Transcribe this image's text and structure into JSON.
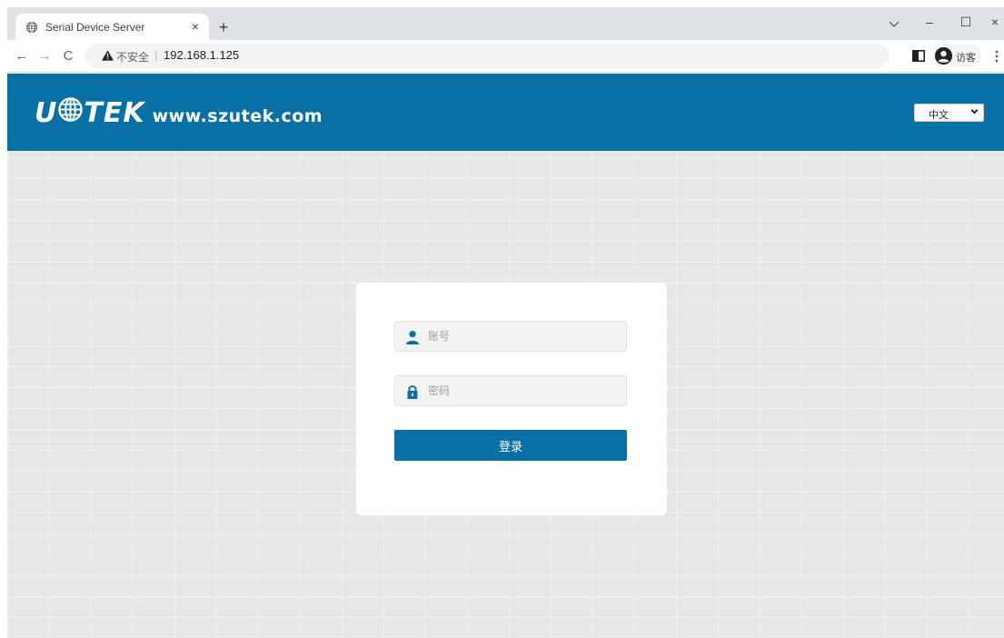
{
  "browser": {
    "tab": {
      "title": "Serial Device Server",
      "close_glyph": "×"
    },
    "new_tab_glyph": "+",
    "window": {
      "minimize_glyph": "–",
      "maximize_glyph": "☐",
      "close_glyph": "×"
    },
    "nav": {
      "back_glyph": "←",
      "forward_glyph": "→",
      "reload_glyph": "C"
    },
    "address": {
      "security_label": "不安全",
      "separator": "|",
      "url": "192.168.1.125"
    },
    "profile": {
      "label": "访客"
    },
    "icons": [
      "globe-icon",
      "tab-search-icon",
      "warning-icon",
      "side-panel-icon",
      "profile-icon",
      "kebab-menu-icon"
    ]
  },
  "header": {
    "brand": "UOTEK",
    "brand_left": "U",
    "brand_right": "TEK",
    "website": "www.szutek.com",
    "language": {
      "selected": "中文"
    },
    "color": "#0870a4"
  },
  "login": {
    "username_placeholder": "账号",
    "password_placeholder": "密码",
    "submit_label": "登录",
    "button_color": "#0870a4",
    "icons": [
      "user-icon",
      "lock-icon"
    ]
  }
}
